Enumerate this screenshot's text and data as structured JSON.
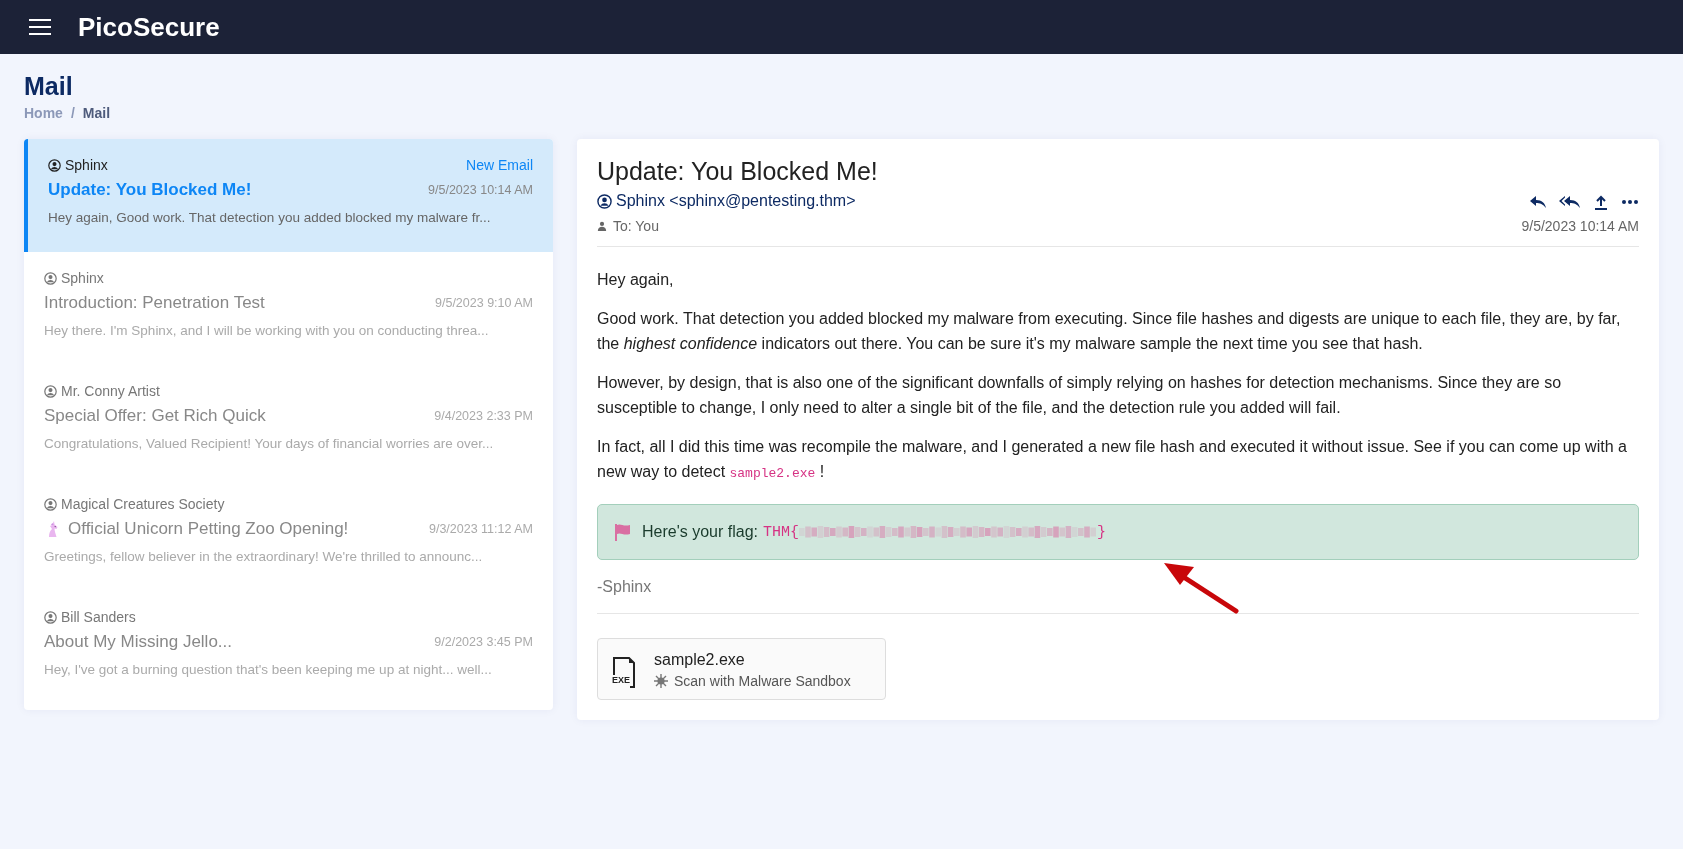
{
  "app": {
    "title": "PicoSecure"
  },
  "page": {
    "title": "Mail",
    "breadcrumb_separator": "/",
    "breadcrumb": [
      {
        "label": "Home",
        "current": false
      },
      {
        "label": "Mail",
        "current": true
      }
    ]
  },
  "inbox": [
    {
      "kind": "plain",
      "sender": "Sphinx",
      "subject": "Update: You Blocked Me!",
      "date": "9/5/2023 10:14 AM",
      "preview": "Hey again, Good work. That detection you added blocked my malware fr...",
      "badge": "New Email",
      "selected": true
    },
    {
      "kind": "plain",
      "sender": "Sphinx",
      "subject": "Introduction: Penetration Test",
      "date": "9/5/2023 9:10 AM",
      "preview": "Hey there. I'm Sphinx, and I will be working with you on conducting threa...",
      "selected": false
    },
    {
      "kind": "plain",
      "sender": "Mr. Conny Artist",
      "subject": "Special Offer: Get Rich Quick",
      "date": "9/4/2023 2:33 PM",
      "preview": "Congratulations, Valued Recipient! Your days of financial worries are over...",
      "selected": false
    },
    {
      "kind": "unicorn",
      "sender": "Magical Creatures Society",
      "subject": "Official Unicorn Petting Zoo Opening!",
      "date": "9/3/2023 11:12 AM",
      "preview": "Greetings, fellow believer in the extraordinary! We're thrilled to announc...",
      "selected": false
    },
    {
      "kind": "plain",
      "sender": "Bill Sanders",
      "subject": "About My Missing Jello...",
      "date": "9/2/2023 3:45 PM",
      "preview": "Hey, I've got a burning question that's been keeping me up at night... well...",
      "selected": false
    }
  ],
  "message": {
    "subject": "Update: You Blocked Me!",
    "from": "Sphinx <sphinx@pentesting.thm>",
    "to": "To: You",
    "date": "9/5/2023 10:14 AM",
    "paragraphs": [
      {
        "text": "Hey again,"
      },
      {
        "text": "Good work. That detection you added blocked my malware from executing. Since file hashes and digests are unique to each file, they are, by far, the *highest confidence* indicators out there. You can be sure it's my malware sample the next time you see that hash."
      },
      {
        "text": "However, by design, that is also one of the significant downfalls of simply relying on hashes for detection mechanisms. Since they are so susceptible to change, I only need to alter a single bit of the file, and the detection rule you added will fail."
      },
      {
        "text": "In fact, all I did this time was recompile the malware, and I generated a new file hash and executed it without issue. See if you can come up with a new way to detect ",
        "code": "sample2.exe",
        "after": " !"
      }
    ],
    "flag": {
      "label": "Here's your flag:",
      "prefix": "THM{",
      "suffix": "}"
    },
    "signature": "-Sphinx",
    "attachment": {
      "name": "sample2.exe",
      "type_label": "EXE",
      "action": "Scan with Malware Sandbox"
    }
  }
}
